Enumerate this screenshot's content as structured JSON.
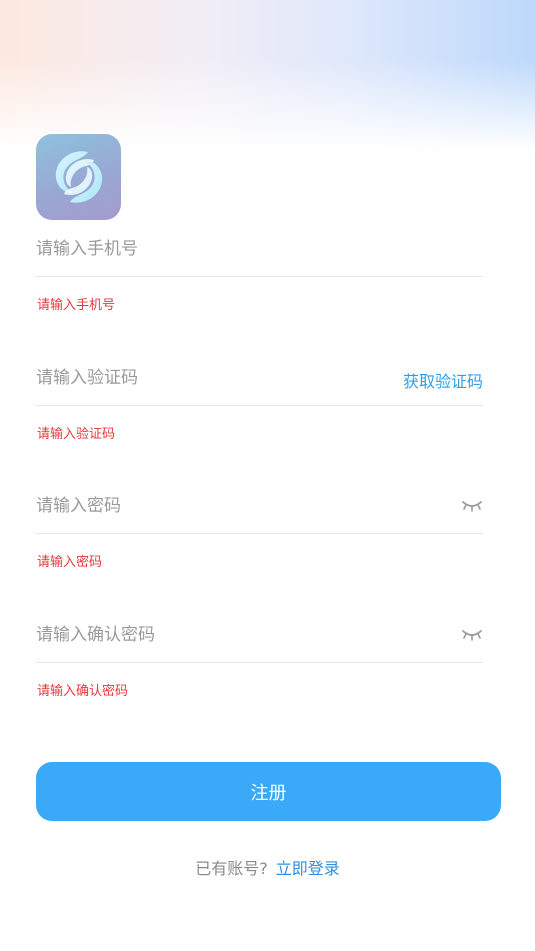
{
  "colors": {
    "accent": "#3aaaf8",
    "link": "#2f9de8",
    "error": "#e4393c",
    "divider": "#e6e6e6",
    "placeholder": "#9a9a9a"
  },
  "logo": {
    "icon": "globe-swirl-icon"
  },
  "phone": {
    "placeholder": "请输入手机号",
    "value": "",
    "error": "请输入手机号"
  },
  "code": {
    "placeholder": "请输入验证码",
    "value": "",
    "action_label": "获取验证码",
    "error": "请输入验证码"
  },
  "password": {
    "placeholder": "请输入密码",
    "value": "",
    "toggle_icon": "eye-closed-icon",
    "error": "请输入密码"
  },
  "confirm_password": {
    "placeholder": "请输入确认密码",
    "value": "",
    "toggle_icon": "eye-closed-icon",
    "error": "请输入确认密码"
  },
  "submit": {
    "label": "注册"
  },
  "footer": {
    "question": "已有账号?",
    "login_link": "立即登录"
  }
}
